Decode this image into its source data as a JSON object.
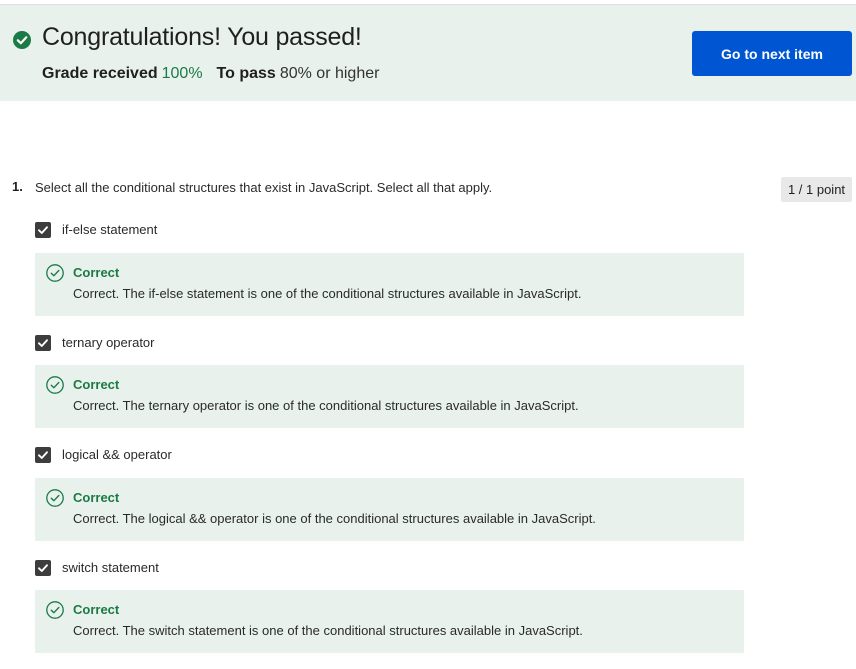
{
  "banner": {
    "title": "Congratulations! You passed!",
    "grade_label": "Grade received",
    "grade_value": "100%",
    "pass_label": "To pass",
    "pass_value": "80% or higher",
    "next_button_label": "Go to next item",
    "check_icon": "check-circle-filled-icon"
  },
  "question": {
    "number": "1.",
    "text": "Select all the conditional structures that exist in JavaScript. Select all that apply.",
    "points": "1 / 1 point",
    "options": [
      {
        "label": "if-else statement",
        "checked": true,
        "feedback_title": "Correct",
        "feedback_text": "Correct. The if-else statement is one of the conditional structures available in JavaScript."
      },
      {
        "label": "ternary operator",
        "checked": true,
        "feedback_title": "Correct",
        "feedback_text": "Correct. The ternary operator is one of the conditional structures available in JavaScript."
      },
      {
        "label": "logical && operator",
        "checked": true,
        "feedback_title": "Correct",
        "feedback_text": "Correct. The logical && operator is one of the conditional structures available in JavaScript."
      },
      {
        "label": "switch statement",
        "checked": true,
        "feedback_title": "Correct",
        "feedback_text": "Correct. The switch statement is one of the conditional structures available in JavaScript."
      }
    ]
  },
  "colors": {
    "accent_blue": "#0056d2",
    "success_green": "#1b7b46",
    "success_bg": "#e9f1ed"
  }
}
